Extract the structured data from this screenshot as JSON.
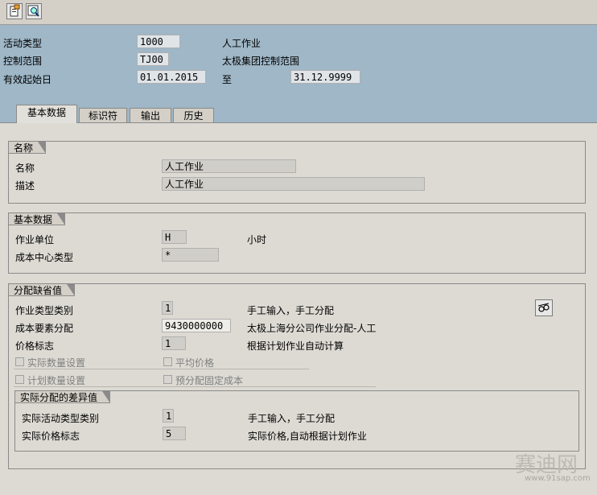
{
  "toolbar": {
    "icons": [
      "new-document-icon",
      "search-icon"
    ]
  },
  "header": {
    "activity_type_label": "活动类型",
    "activity_type_value": "1000",
    "activity_type_desc": "人工作业",
    "controlling_area_label": "控制范围",
    "controlling_area_value": "TJ00",
    "controlling_area_desc": "太极集团控制范围",
    "valid_from_label": "有效起始日",
    "valid_from_value": "01.01.2015",
    "to_label": "至",
    "valid_to_value": "31.12.9999"
  },
  "tabs": [
    {
      "label": "基本数据",
      "active": true
    },
    {
      "label": "标识符",
      "active": false
    },
    {
      "label": "输出",
      "active": false
    },
    {
      "label": "历史",
      "active": false
    }
  ],
  "name_group": {
    "title": "名称",
    "name_label": "名称",
    "name_value": "人工作业",
    "desc_label": "描述",
    "desc_value": "人工作业"
  },
  "basic_group": {
    "title": "基本数据",
    "unit_label": "作业单位",
    "unit_value": "H",
    "unit_desc": "小时",
    "cc_category_label": "成本中心类型",
    "cc_category_value": "*"
  },
  "alloc_group": {
    "title": "分配缺省值",
    "atype_cat_label": "作业类型类别",
    "atype_cat_value": "1",
    "atype_cat_desc": "手工输入，手工分配",
    "cost_elem_label": "成本要素分配",
    "cost_elem_value": "9430000000",
    "cost_elem_desc": "太极上海分公司作业分配-人工",
    "price_ind_label": "价格标志",
    "price_ind_value": "1",
    "price_ind_desc": "根据计划作业自动计算",
    "actual_qty_label": "实际数量设置",
    "avg_price_label": "平均价格",
    "plan_qty_label": "计划数量设置",
    "predistrib_label": "预分配固定成本"
  },
  "variance_group": {
    "title": "实际分配的差异值",
    "actual_atype_label": "实际活动类型类别",
    "actual_atype_value": "1",
    "actual_atype_desc": "手工输入，手工分配",
    "actual_price_label": "实际价格标志",
    "actual_price_value": "5",
    "actual_price_desc": "实际价格,自动根据计划作业"
  },
  "watermark": {
    "text": "赛迪网",
    "url": "www.91sap.com"
  }
}
